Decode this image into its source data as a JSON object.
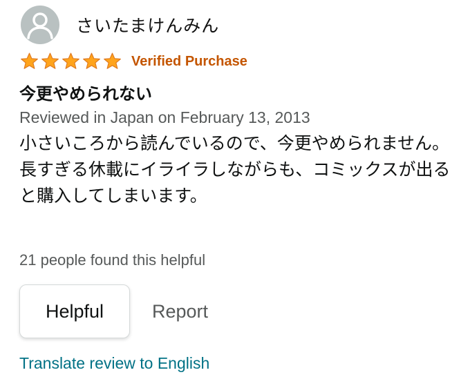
{
  "reviewer": {
    "name": "さいたまけんみん",
    "avatar_icon": "person-silhouette-icon",
    "avatar_bg": "#b9c1c1"
  },
  "rating": {
    "stars": 5,
    "max": 5,
    "star_color": "#ffa41c",
    "star_icon": "star-icon"
  },
  "badge": {
    "verified_label": "Verified Purchase",
    "color": "#c45500"
  },
  "review": {
    "title": "今更やめられない",
    "meta": "Reviewed in Japan on February 13, 2013",
    "body_lines": [
      "小さいころから読んでいるので、今更やめられません。",
      "長すぎる休載にイライラしながらも、コミックスが出ると購入してしまいます。"
    ]
  },
  "feedback": {
    "helpful_count_text": "21 people found this helpful",
    "helpful_button": "Helpful",
    "report_link": "Report",
    "translate_link": "Translate review to English",
    "link_color": "#007185"
  }
}
